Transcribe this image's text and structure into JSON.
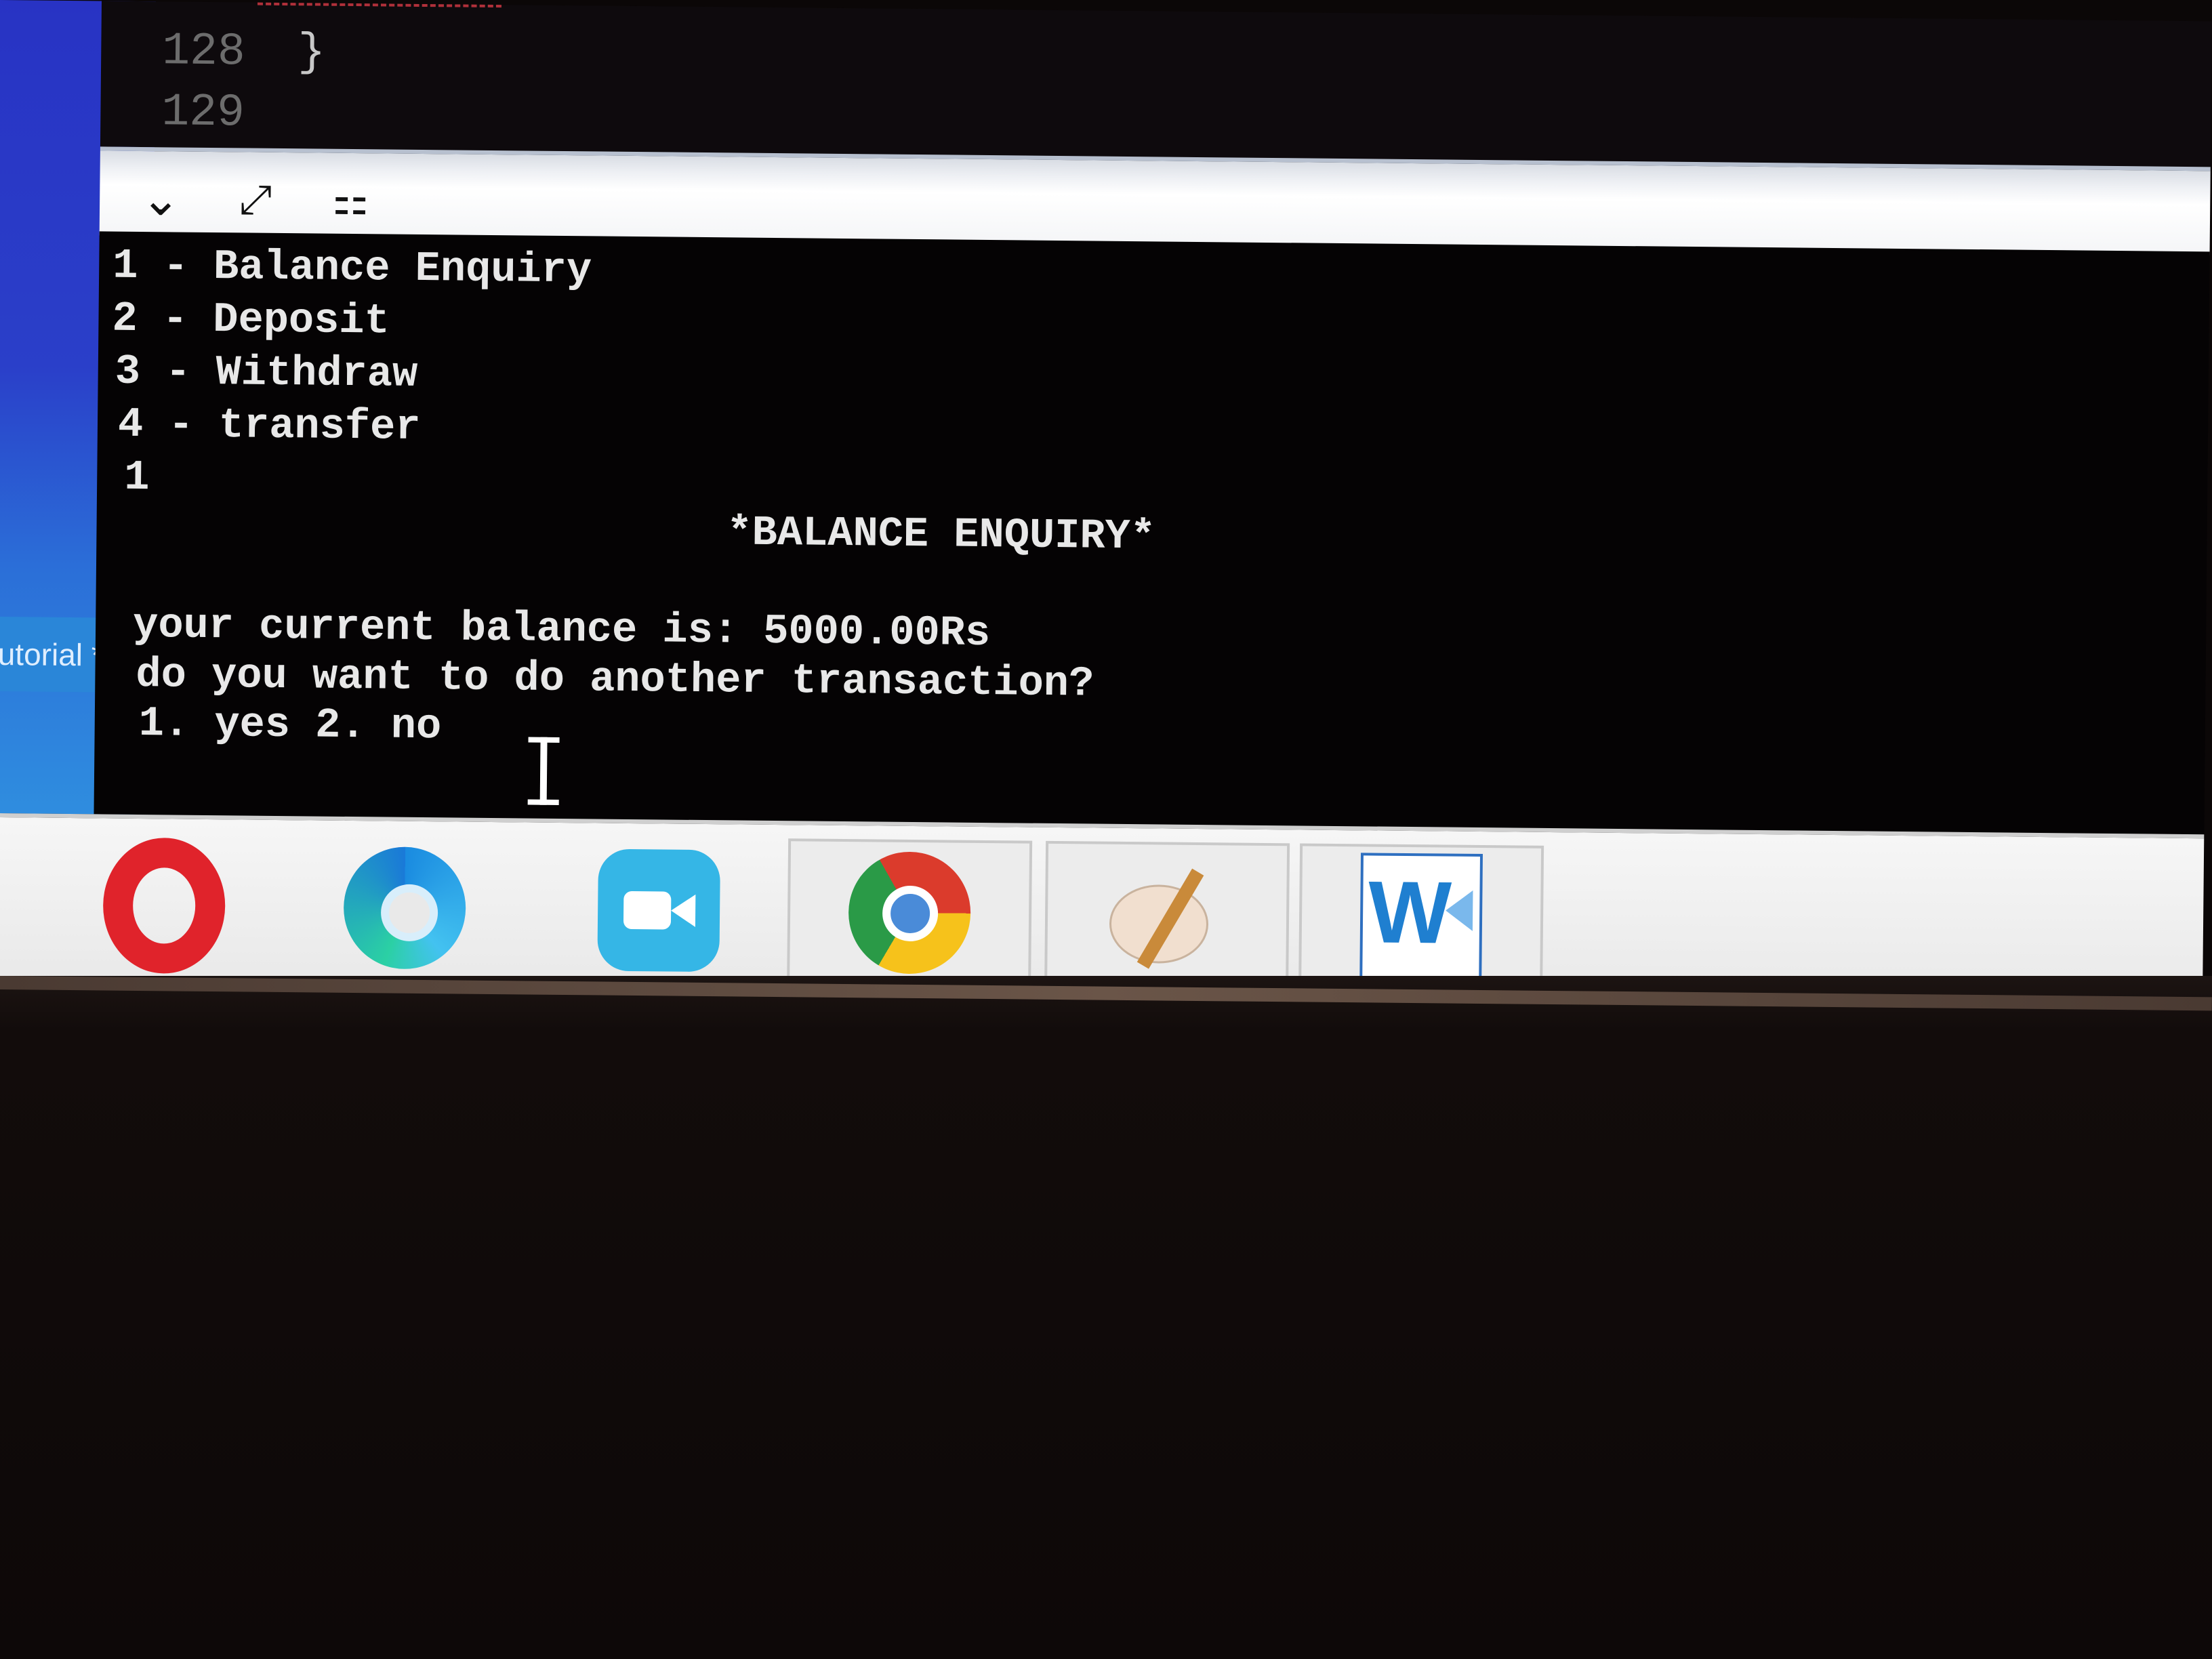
{
  "editor": {
    "lines": [
      {
        "num": "128",
        "text": "}"
      },
      {
        "num": "129",
        "text": ""
      }
    ]
  },
  "side_tab": {
    "label": "utorial *"
  },
  "console": {
    "lines": [
      "1 - Balance Enquiry",
      "2 - Deposit",
      "3 - Withdraw",
      "4 - transfer",
      "1",
      "*BALANCE ENQUIRY*",
      "your current balance is: 5000.00Rs",
      "do you want to do another transaction?",
      "1. yes 2. no"
    ]
  },
  "toolbar": {
    "icons": [
      "chevron-down-icon",
      "expand-icon",
      "pin-icon"
    ]
  },
  "taskbar": {
    "apps": [
      "opera-icon",
      "edge-icon",
      "zoom-icon",
      "chrome-icon",
      "paint-icon",
      "word-icon"
    ],
    "accent_colors": {
      "opera": "#e0232b",
      "zoom": "#35b6e6",
      "word": "#1f7fd0"
    }
  }
}
